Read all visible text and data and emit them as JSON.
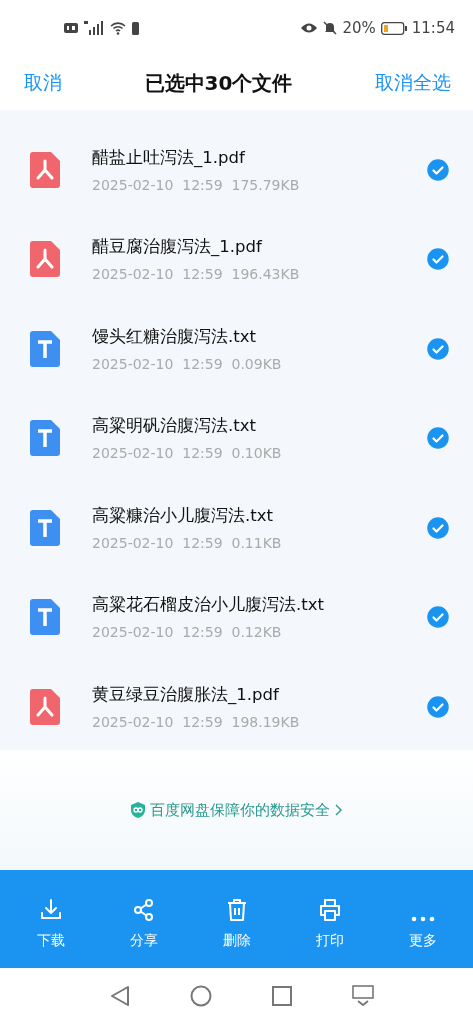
{
  "status_bar": {
    "battery_text": "20%",
    "time": "11:54"
  },
  "header": {
    "left": "取消",
    "title": "已选中30个文件",
    "right": "取消全选"
  },
  "files": [
    {
      "kind": "pdf",
      "name": "醋盐止吐泻法_1.pdf",
      "meta": "2025-02-10  12:59  175.79KB",
      "selected": true
    },
    {
      "kind": "pdf",
      "name": "醋豆腐治腹泻法_1.pdf",
      "meta": "2025-02-10  12:59  196.43KB",
      "selected": true
    },
    {
      "kind": "txt",
      "name": "馒头红糖治腹泻法.txt",
      "meta": "2025-02-10  12:59  0.09KB",
      "selected": true
    },
    {
      "kind": "txt",
      "name": "高粱明矾治腹泻法.txt",
      "meta": "2025-02-10  12:59  0.10KB",
      "selected": true
    },
    {
      "kind": "txt",
      "name": "高粱糠治小儿腹泻法.txt",
      "meta": "2025-02-10  12:59  0.11KB",
      "selected": true
    },
    {
      "kind": "txt",
      "name": "高粱花石榴皮治小儿腹泻法.txt",
      "meta": "2025-02-10  12:59  0.12KB",
      "selected": true
    },
    {
      "kind": "pdf",
      "name": "黄豆绿豆治腹胀法_1.pdf",
      "meta": "2025-02-10  12:59  198.19KB",
      "selected": true
    }
  ],
  "security_link": "百度网盘保障你的数据安全",
  "toolbar": [
    {
      "kind": "download",
      "label": "下载"
    },
    {
      "kind": "share",
      "label": "分享"
    },
    {
      "kind": "delete",
      "label": "删除"
    },
    {
      "kind": "print",
      "label": "打印"
    },
    {
      "kind": "more",
      "label": "更多"
    }
  ]
}
